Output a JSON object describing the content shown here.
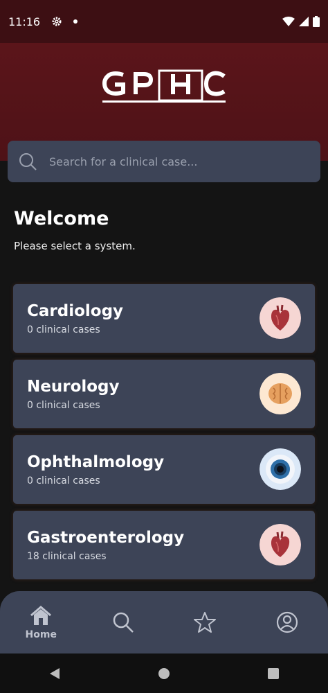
{
  "status_bar": {
    "time": "11:16"
  },
  "header": {
    "logo_text": "GPHC"
  },
  "search": {
    "placeholder": "Search for a clinical case..."
  },
  "welcome": {
    "title": "Welcome",
    "subtitle": "Please select a system."
  },
  "systems": [
    {
      "name": "Cardiology",
      "count": "0 clinical cases",
      "icon": "heart-icon"
    },
    {
      "name": "Neurology",
      "count": "0 clinical cases",
      "icon": "brain-icon"
    },
    {
      "name": "Ophthalmology",
      "count": "0 clinical cases",
      "icon": "eye-icon"
    },
    {
      "name": "Gastroenterology",
      "count": "18 clinical cases",
      "icon": "heart-icon"
    }
  ],
  "bottom_nav": {
    "home": "Home",
    "items": [
      "home-icon",
      "search-icon",
      "star-icon",
      "profile-icon"
    ]
  },
  "colors": {
    "header_bg": "#5b151a",
    "status_bg": "#3d0f13",
    "card_bg": "#3d4457",
    "page_bg": "#141414"
  }
}
